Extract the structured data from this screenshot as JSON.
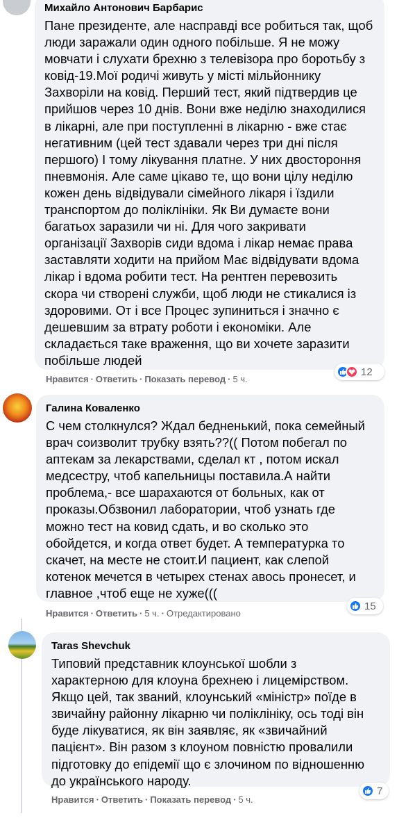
{
  "comments": [
    {
      "author": "Михайло Антонович Барбарис",
      "lines": [
        "Пане президенте, але насправді все робиться так, щоб",
        "люди заражали один одного побільше. Я не можу",
        "мовчати і слухати брехню з телевізора про боротьбу з",
        "ковід-19.Мої родичі живуть у місті мільйоннику",
        "Захворіли на ковід. Перший тест, який підтвердив це",
        "прийшов через 10 днів. Вони вже неділю знаходилися",
        "в лікарні, але при поступленні в лікарню - вже стає",
        "негативним (цей тест здавали через три дні після",
        "першого) І тому лікування платне. У них двостороння",
        "пневмонія. Але саме цікаво те, що вони цілу неділю",
        "кожен день відвідували сімейного лікаря і їздили",
        "транспортом до поліклініки. Як Ви думаєте вони",
        "багатьох заразили чи ні. Для чого закривати",
        "організації Захворів сиди вдома і лікар немає права",
        "заставляти ходити на прийом Має відвідувати вдома",
        "лікар і вдома робити тест. На рентген перевозить",
        "скора чи створені служби, щоб люди не стикалися із",
        "здоровими. От і все Процес зупиниться і значно є",
        "дешевшим за втрату роботи і економіки. Але",
        "складається таке враження, що ви хочете заразити",
        "побільше людей"
      ],
      "actions": [
        "Нравится",
        "Ответить",
        "Показать перевод"
      ],
      "time": "5 ч.",
      "reaction_count": "12"
    },
    {
      "author": "Галина Коваленко",
      "lines": [
        "С чем столкнулся? Ждал бедненький, пока семейный",
        "врач соизволит трубку взять??(( Потом побегал по",
        "аптекам за лекарствами, сделал кт , потом искал",
        "медсестру, чтоб капельницы поставила.А найти",
        "проблема,- все шарахаются от больных, как от",
        "проказы.Обзвонил лаборатории, чтоб узнать где",
        "можно тест на ковид сдать, и во сколько это",
        "обойдется, и когда ответ будет. А температурка то",
        "скачет, на месте не стоит.И пациент, как слепой",
        "котенок мечется в четырех стенах авось пронесет, и",
        "главное ,чтоб еще не хуже((("
      ],
      "actions": [
        "Нравится",
        "Ответить"
      ],
      "time": "5 ч.",
      "edited": "Отредактировано",
      "reaction_count": "15"
    },
    {
      "author": "Taras Shevchuk",
      "lines": [
        "Типовий представник клоунської шобли з",
        "характерною для клоуна брехнею і лицемірством.",
        "Якщо цей, так званий, клоунський «міністр» поїде в",
        "звичайну районну лікарню чи поліклініку, ось тоді він",
        "буде лікуватися, як він заявляє, як «звичайний",
        "пацієнт». Він разом з клоуном повністю провалили",
        "підготовку до епідемії що є злочином по відношенню",
        "до українського народу."
      ],
      "actions": [
        "Нравится",
        "Ответить",
        "Показать перевод"
      ],
      "time": "5 ч.",
      "reaction_count": "7"
    }
  ],
  "colors": {
    "bubble": "#f0f2f5",
    "meta_text": "#65676b",
    "like_blue": "#1877f2",
    "love_red": "#f33e58"
  },
  "icons": [
    "like-icon",
    "love-icon"
  ]
}
